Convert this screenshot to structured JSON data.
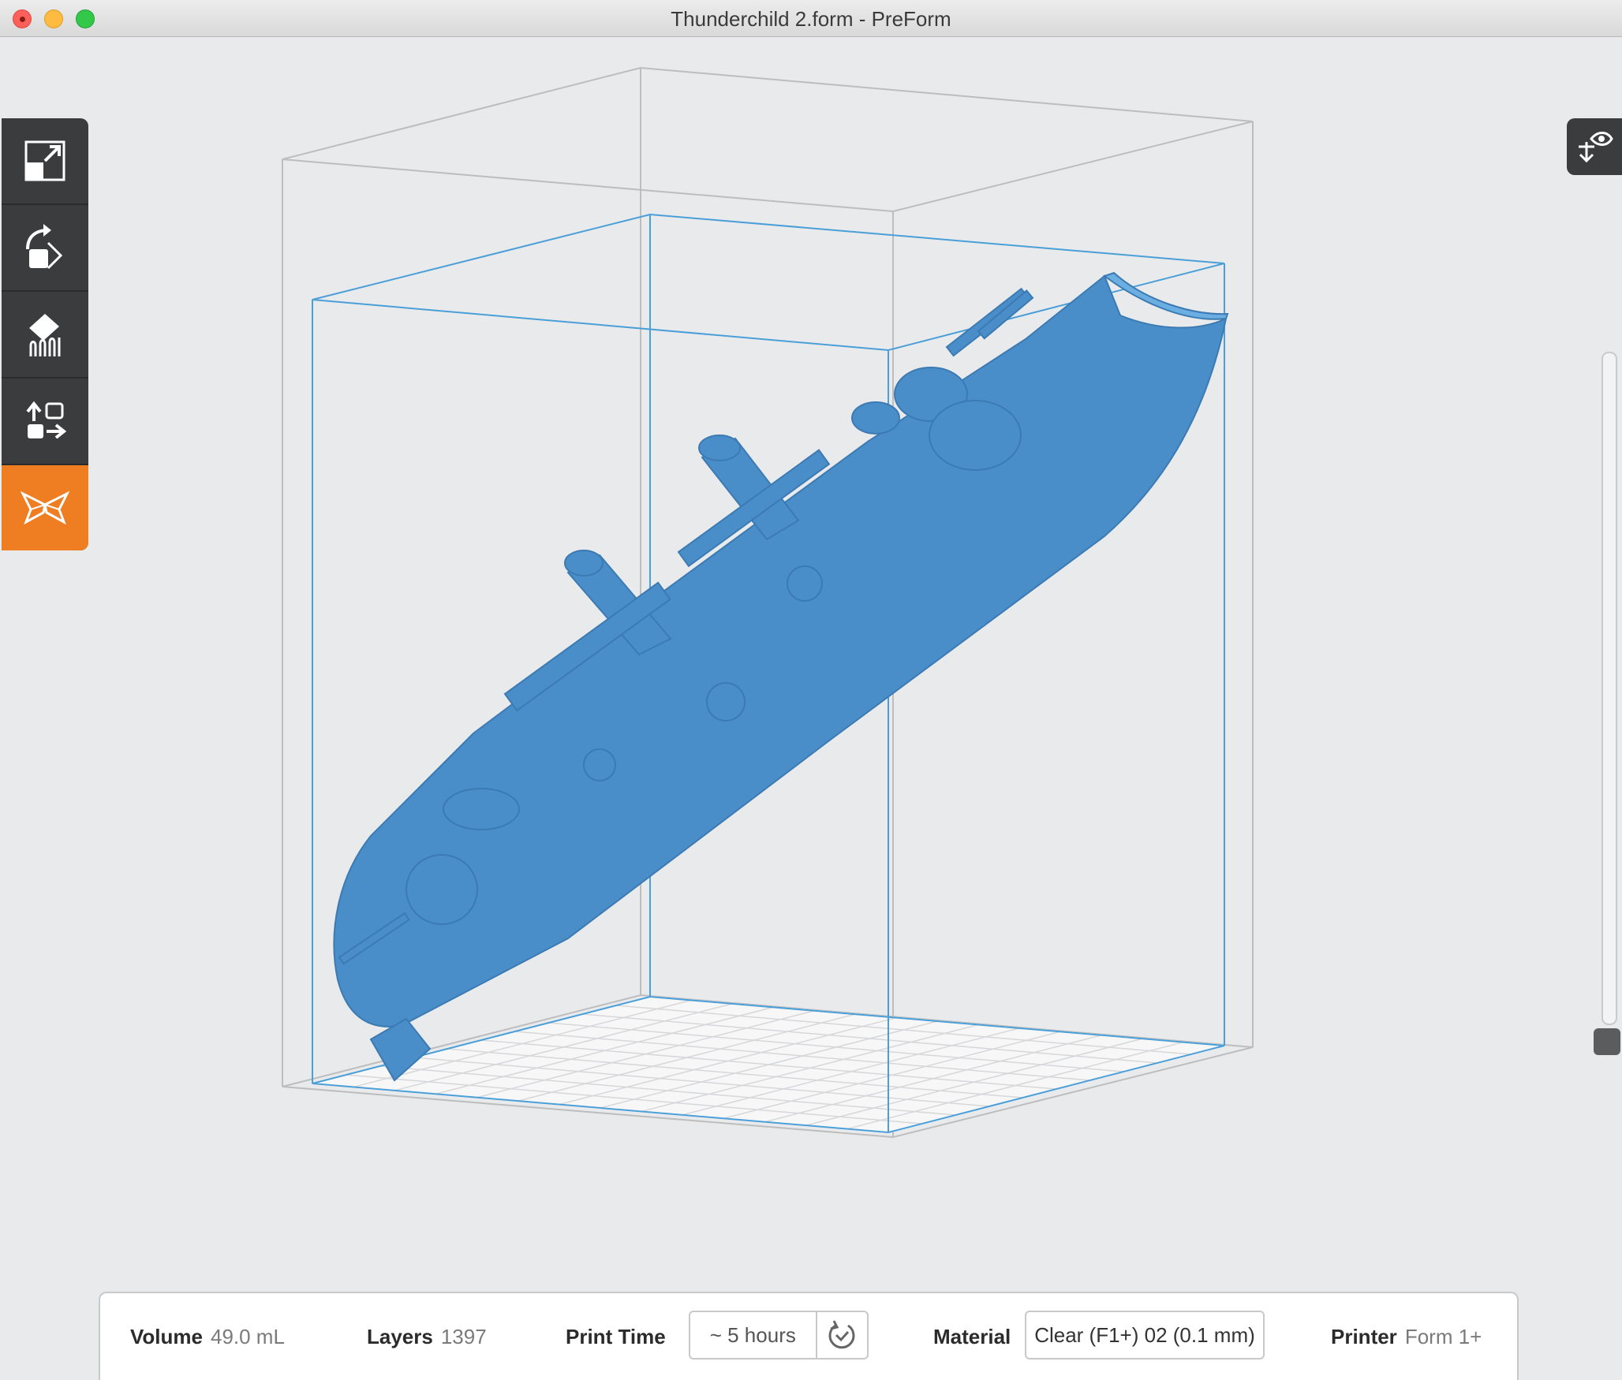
{
  "window": {
    "title": "Thunderchild 2.form - PreForm"
  },
  "toolbar": {
    "tools": [
      {
        "name": "scale-tool-button",
        "icon": "scale-icon"
      },
      {
        "name": "orient-tool-button",
        "icon": "rotate-icon"
      },
      {
        "name": "supports-tool-button",
        "icon": "supports-icon"
      },
      {
        "name": "layout-tool-button",
        "icon": "layout-icon"
      },
      {
        "name": "print-button",
        "icon": "formlabs-butterfly-icon",
        "active": true
      }
    ]
  },
  "view_toggle": {
    "icon": "eye-view-icon"
  },
  "model": {
    "color": "#4a8ec9",
    "outline_color": "#4a9fd8"
  },
  "status": {
    "volume_label": "Volume",
    "volume_value": "49.0 mL",
    "layers_label": "Layers",
    "layers_value": "1397",
    "print_time_label": "Print Time",
    "print_time_value": "~ 5 hours",
    "material_label": "Material",
    "material_value": "Clear (F1+) 02 (0.1 mm)",
    "printer_label": "Printer",
    "printer_value": "Form 1+"
  },
  "colors": {
    "accent": "#ef7d22",
    "background": "#e9eaec",
    "toolbar": "#3a3c3e"
  }
}
